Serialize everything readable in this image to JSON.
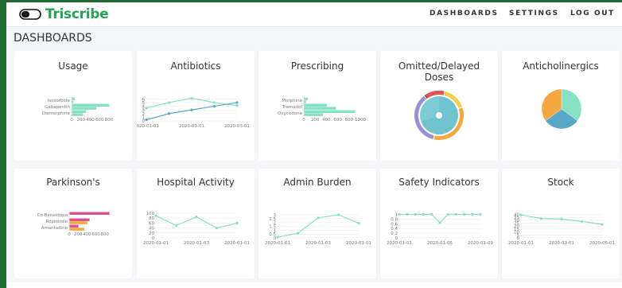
{
  "app": {
    "name": "Triscribe"
  },
  "nav": {
    "dashboards": "DASHBOARDS",
    "settings": "SETTINGS",
    "logout": "LOG OUT"
  },
  "page": {
    "title": "DASHBOARDS"
  },
  "colors": {
    "brand": "#23a455",
    "frame": "#1e6b2f",
    "teal": "#86e0c4",
    "blue": "#5aa8c8",
    "orange": "#f5a742",
    "pink": "#d9548f",
    "red": "#e05555",
    "yellow": "#f2d04b",
    "purple": "#9b8fd6"
  },
  "cards": [
    {
      "title": "Usage"
    },
    {
      "title": "Antibiotics"
    },
    {
      "title": "Prescribing"
    },
    {
      "title": "Omitted/Delayed Doses"
    },
    {
      "title": "Anticholinergics"
    },
    {
      "title": "Parkinson's"
    },
    {
      "title": "Hospital Activity"
    },
    {
      "title": "Admin Burden"
    },
    {
      "title": "Safety Indicators"
    },
    {
      "title": "Stock"
    }
  ],
  "chart_data": [
    {
      "type": "bar",
      "orientation": "horizontal",
      "categories": [
        "Isosorbide",
        "Gabapentin",
        "Diamorphine"
      ],
      "series": [
        {
          "values": [
            60,
            800,
            300
          ]
        },
        {
          "values": [
            30,
            520,
            230
          ]
        }
      ],
      "xticks": [
        "0",
        "200",
        "400",
        "600",
        "800"
      ],
      "xlim": [
        0,
        850
      ]
    },
    {
      "type": "line",
      "x": [
        "2020-01-01",
        "2020-02-01",
        "2020-03-01",
        "2020-04-01",
        "2020-05-01"
      ],
      "x_tick_labels": [
        "2020-01-01",
        "2020-03-01",
        "2020-03-01"
      ],
      "series": [
        {
          "values": [
            3.5,
            5,
            6.2,
            5,
            4.2
          ]
        },
        {
          "values": [
            0.3,
            2,
            3,
            4,
            5
          ]
        }
      ],
      "yticks": [
        "0",
        "1",
        "2",
        "3",
        "4",
        "5",
        "6"
      ],
      "ylim": [
        0,
        6.5
      ]
    },
    {
      "type": "bar",
      "orientation": "horizontal",
      "categories": [
        "Morphine",
        "Tramadol",
        "Oxycodone"
      ],
      "series": [
        {
          "values": [
            60,
            400,
            900
          ]
        },
        {
          "values": [
            30,
            560,
            330
          ]
        }
      ],
      "xticks": [
        "0",
        "200",
        "400",
        "600",
        "800",
        "1000"
      ],
      "xlim": [
        0,
        1000
      ]
    },
    {
      "type": "pie",
      "variant": "nested-donut",
      "rings": [
        {
          "values": [
            70,
            30
          ]
        },
        {
          "values": [
            16,
            34,
            36,
            14
          ]
        }
      ]
    },
    {
      "type": "pie",
      "values": [
        35,
        30,
        35
      ]
    },
    {
      "type": "bar",
      "orientation": "horizontal",
      "categories": [
        "Co-Beneldopa",
        "Ropinirole",
        "Amantadine"
      ],
      "series": [
        {
          "values": [
            900,
            450,
            200
          ]
        },
        {
          "values": [
            0,
            400,
            330
          ]
        }
      ],
      "xticks": [
        "0",
        "200",
        "400",
        "600",
        "800"
      ],
      "xlim": [
        0,
        950
      ]
    },
    {
      "type": "line",
      "x": [
        "2020-01-01",
        "2020-02-01",
        "2020-03-01",
        "2020-04-01",
        "2020-05-01"
      ],
      "x_tick_labels": [
        "2020-01-01",
        "2020-01-03",
        "2020-01-01"
      ],
      "series": [
        {
          "values": [
            90,
            50,
            85,
            40,
            60
          ]
        }
      ],
      "yticks": [
        "0",
        "20",
        "40",
        "60",
        "80",
        "100"
      ],
      "ylim": [
        0,
        100
      ]
    },
    {
      "type": "line",
      "x": [
        "2020-01-01",
        "2020-01-02",
        "2020-01-03",
        "2020-01-04",
        "2020-01-05"
      ],
      "x_tick_labels": [
        "2020-01-01",
        "2020-01-03",
        "2020-01-01"
      ],
      "series": [
        {
          "values": [
            0.1,
            0.6,
            2.6,
            3.0,
            1.9
          ]
        }
      ],
      "yticks": [
        "0",
        "0.5",
        "1",
        "1.5",
        "2",
        "2.5",
        "3"
      ],
      "ylim": [
        0,
        3.2
      ]
    },
    {
      "type": "line",
      "x": [
        "2020-01-01",
        "2020-01-02",
        "2020-01-03",
        "2020-01-04",
        "2020-01-05",
        "2020-01-06",
        "2020-01-07",
        "2020-01-08",
        "2020-01-09",
        "2020-01-10",
        "2020-01-11"
      ],
      "x_tick_labels": [
        "2020-01-01",
        "2020-01-05",
        "2020-01-09"
      ],
      "series": [
        {
          "values": [
            1,
            1,
            1,
            1,
            1,
            0.65,
            1,
            1,
            1,
            1,
            1
          ]
        }
      ],
      "yticks": [
        "0",
        "0.2",
        "0.4",
        "0.6",
        "0.8",
        "1"
      ],
      "ylim": [
        0,
        1.05
      ]
    },
    {
      "type": "line",
      "x": [
        "2020-01-01",
        "2020-02-01",
        "2020-03-01",
        "2020-04-01",
        "2020-05-01"
      ],
      "x_tick_labels": [
        "2020-01-01",
        "2020-03-01",
        "2020-05-01"
      ],
      "series": [
        {
          "values": [
            39,
            33,
            32,
            28,
            23
          ]
        }
      ],
      "yticks": [
        "0",
        "5",
        "10",
        "15",
        "20",
        "25",
        "30",
        "35",
        "40"
      ],
      "ylim": [
        0,
        42
      ]
    }
  ]
}
